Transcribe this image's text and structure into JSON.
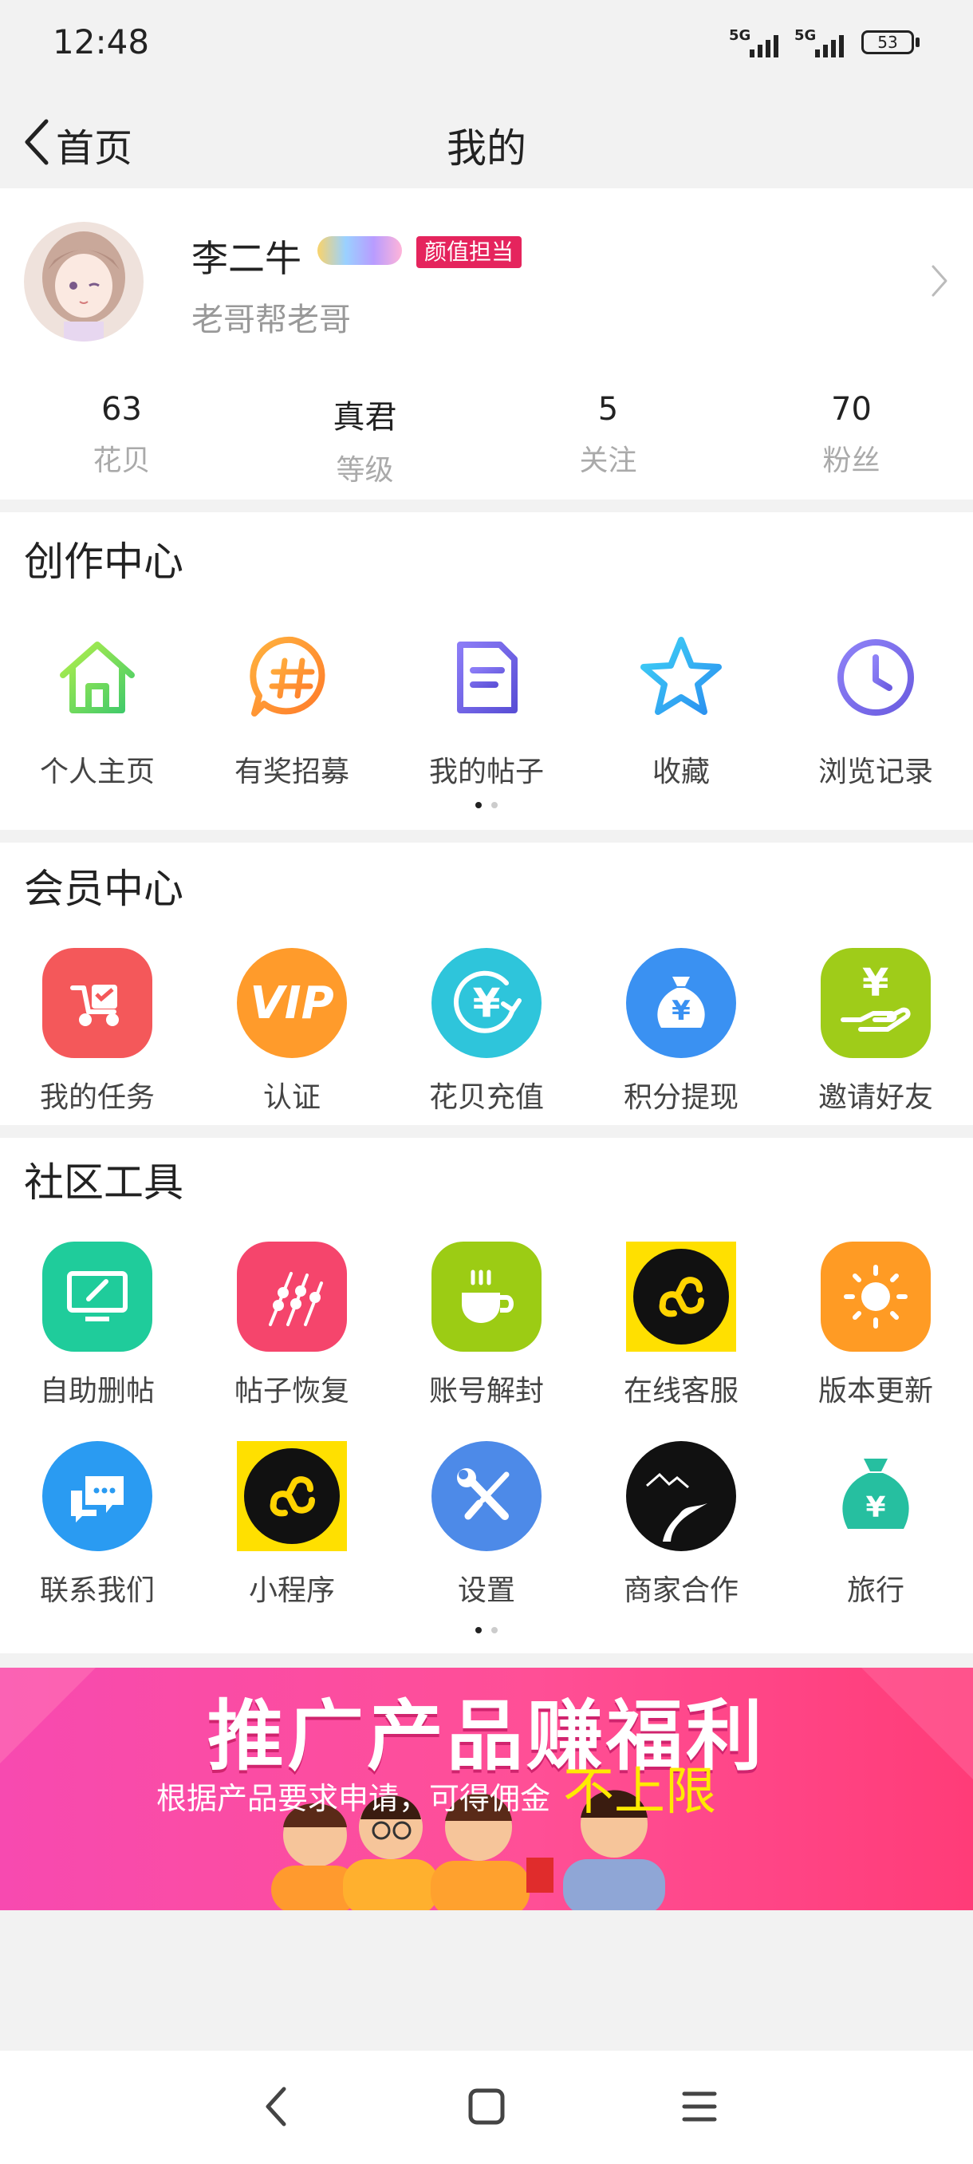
{
  "status_bar": {
    "time": "12:48",
    "signal1": "5G",
    "signal2": "5G",
    "battery": "53"
  },
  "header": {
    "back_label": "首页",
    "title": "我的"
  },
  "profile": {
    "name": "李二牛",
    "tag": "颜值担当",
    "signature": "老哥帮老哥",
    "stats": [
      {
        "value": "63",
        "label": "花贝"
      },
      {
        "value": "真君",
        "label": "等级"
      },
      {
        "value": "5",
        "label": "关注"
      },
      {
        "value": "70",
        "label": "粉丝"
      }
    ]
  },
  "creation_center": {
    "title": "创作中心",
    "items": [
      {
        "label": "个人主页",
        "icon": "home-icon"
      },
      {
        "label": "有奖招募",
        "icon": "hashtag-bubble-icon"
      },
      {
        "label": "我的帖子",
        "icon": "document-icon"
      },
      {
        "label": "收藏",
        "icon": "star-icon"
      },
      {
        "label": "浏览记录",
        "icon": "clock-icon"
      }
    ]
  },
  "member_center": {
    "title": "会员中心",
    "items": [
      {
        "label": "我的任务",
        "icon": "task-scooter-icon"
      },
      {
        "label": "认证",
        "icon": "vip-icon",
        "icon_text": "VIP"
      },
      {
        "label": "花贝充值",
        "icon": "yuan-recharge-icon",
        "icon_text": "¥"
      },
      {
        "label": "积分提现",
        "icon": "money-bag-icon",
        "icon_text": "¥"
      },
      {
        "label": "邀请好友",
        "icon": "hand-yuan-icon",
        "icon_text": "¥"
      }
    ]
  },
  "community_tools": {
    "title": "社区工具",
    "row1": [
      {
        "label": "自助删帖",
        "icon": "monitor-edit-icon"
      },
      {
        "label": "帖子恢复",
        "icon": "skewers-icon"
      },
      {
        "label": "账号解封",
        "icon": "coffee-cup-icon"
      },
      {
        "label": "在线客服",
        "icon": "mini-program-icon"
      },
      {
        "label": "版本更新",
        "icon": "sun-icon"
      }
    ],
    "row2": [
      {
        "label": "联系我们",
        "icon": "chat-bubbles-icon"
      },
      {
        "label": "小程序",
        "icon": "mini-program-icon"
      },
      {
        "label": "设置",
        "icon": "wrench-screwdriver-icon"
      },
      {
        "label": "商家合作",
        "icon": "road-landscape-icon"
      },
      {
        "label": "旅行",
        "icon": "money-bag-icon",
        "icon_text": "¥"
      }
    ]
  },
  "banner": {
    "title": "推广产品赚福利",
    "subtitle": "根据产品要求申请，可得佣金",
    "emphasis": "不上限"
  },
  "colors": {
    "accent_pink": "#e5245d",
    "banner_pink": "#ff4f96",
    "mini_program_yellow": "#ffe000"
  }
}
